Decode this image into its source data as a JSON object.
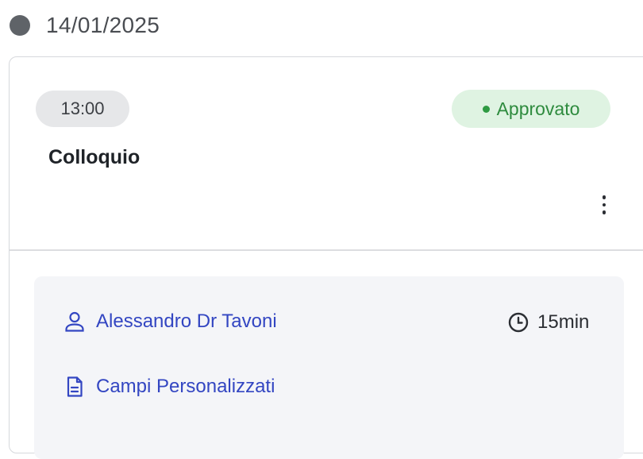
{
  "date_header": {
    "date": "14/01/2025"
  },
  "appointment": {
    "time": "13:00",
    "status": "Approvato",
    "title": "Colloquio",
    "details": {
      "person": "Alessandro Dr Tavoni",
      "duration": "15min",
      "custom_fields": "Campi Personalizzati"
    }
  },
  "icons": {
    "timeline_dot": "timeline-dot-icon",
    "status_dot": "status-dot-icon",
    "more": "more-vertical-icon",
    "person": "user-icon",
    "clock": "clock-icon",
    "document": "document-icon"
  },
  "colors": {
    "status_text": "#2e8b3e",
    "status_bg": "#dff3e2",
    "link": "#3346c2",
    "chip_bg": "#e6e7e9",
    "panel_bg": "#f4f5f8"
  }
}
